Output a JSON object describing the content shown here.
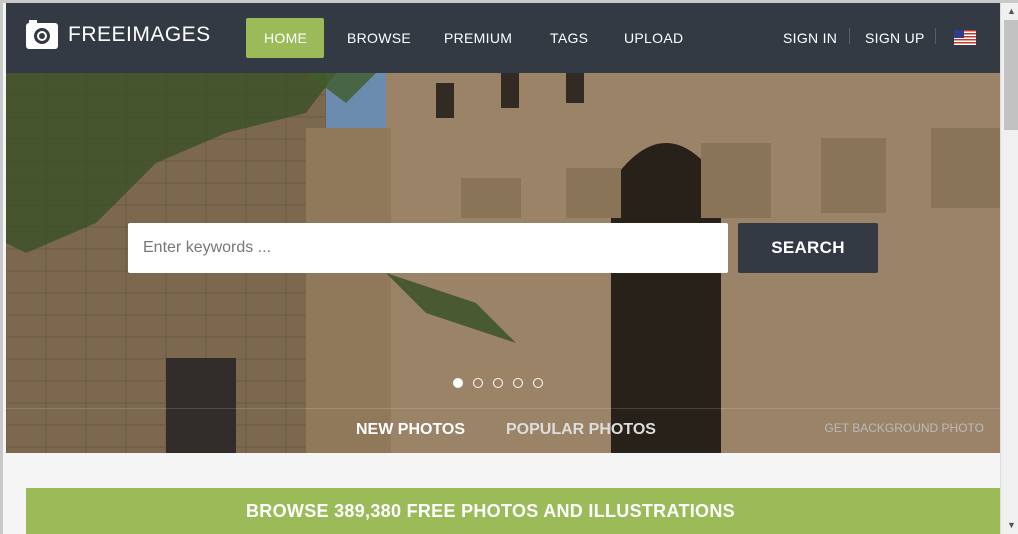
{
  "brand": {
    "name": "FREEIMAGES",
    "icon": "camera-icon"
  },
  "nav": {
    "items": [
      {
        "label": "HOME",
        "active": true
      },
      {
        "label": "BROWSE",
        "active": false
      },
      {
        "label": "PREMIUM",
        "active": false
      },
      {
        "label": "TAGS",
        "active": false
      },
      {
        "label": "UPLOAD",
        "active": false
      }
    ],
    "sign_in": "SIGN IN",
    "sign_up": "SIGN UP",
    "language_flag": "us-flag-icon"
  },
  "hero": {
    "search": {
      "placeholder": "Enter keywords ...",
      "value": ""
    },
    "search_button": "SEARCH",
    "slides": {
      "count": 5,
      "active_index": 0
    },
    "tabs": {
      "new": "NEW PHOTOS",
      "popular": "POPULAR PHOTOS"
    },
    "background_link": "GET BACKGROUND PHOTO"
  },
  "banner": {
    "text": "BROWSE 389,380 FREE PHOTOS AND ILLUSTRATIONS"
  },
  "colors": {
    "nav_bg": "#333a44",
    "accent": "#9bbb59",
    "search_btn": "#333a44"
  }
}
